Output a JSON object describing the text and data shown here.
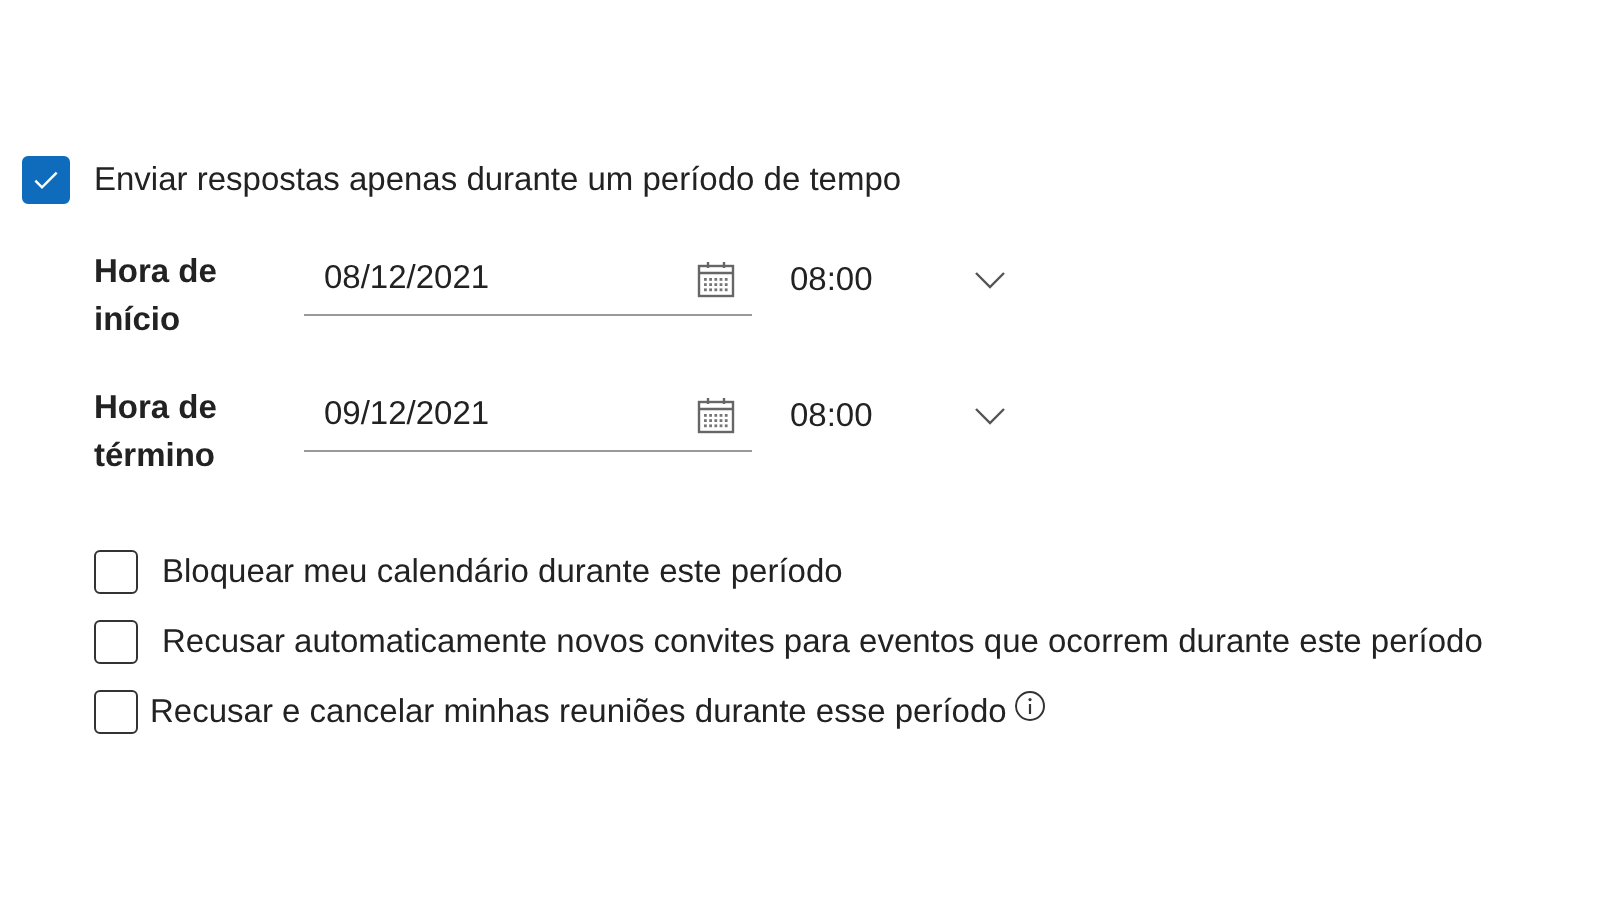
{
  "main_option": {
    "label": "Enviar respostas apenas durante um período de tempo",
    "checked": true
  },
  "time_rows": [
    {
      "label": "Hora de início",
      "date": "08/12/2021",
      "time": "08:00"
    },
    {
      "label": "Hora de término",
      "date": "09/12/2021",
      "time": "08:00"
    }
  ],
  "options": [
    {
      "label": "Bloquear meu calendário durante este período",
      "checked": false,
      "info": false
    },
    {
      "label": "Recusar automaticamente novos convites para eventos que ocorrem durante este período",
      "checked": false,
      "info": false
    },
    {
      "label": "Recusar e cancelar minhas reuniões durante esse período",
      "checked": false,
      "info": true
    }
  ]
}
